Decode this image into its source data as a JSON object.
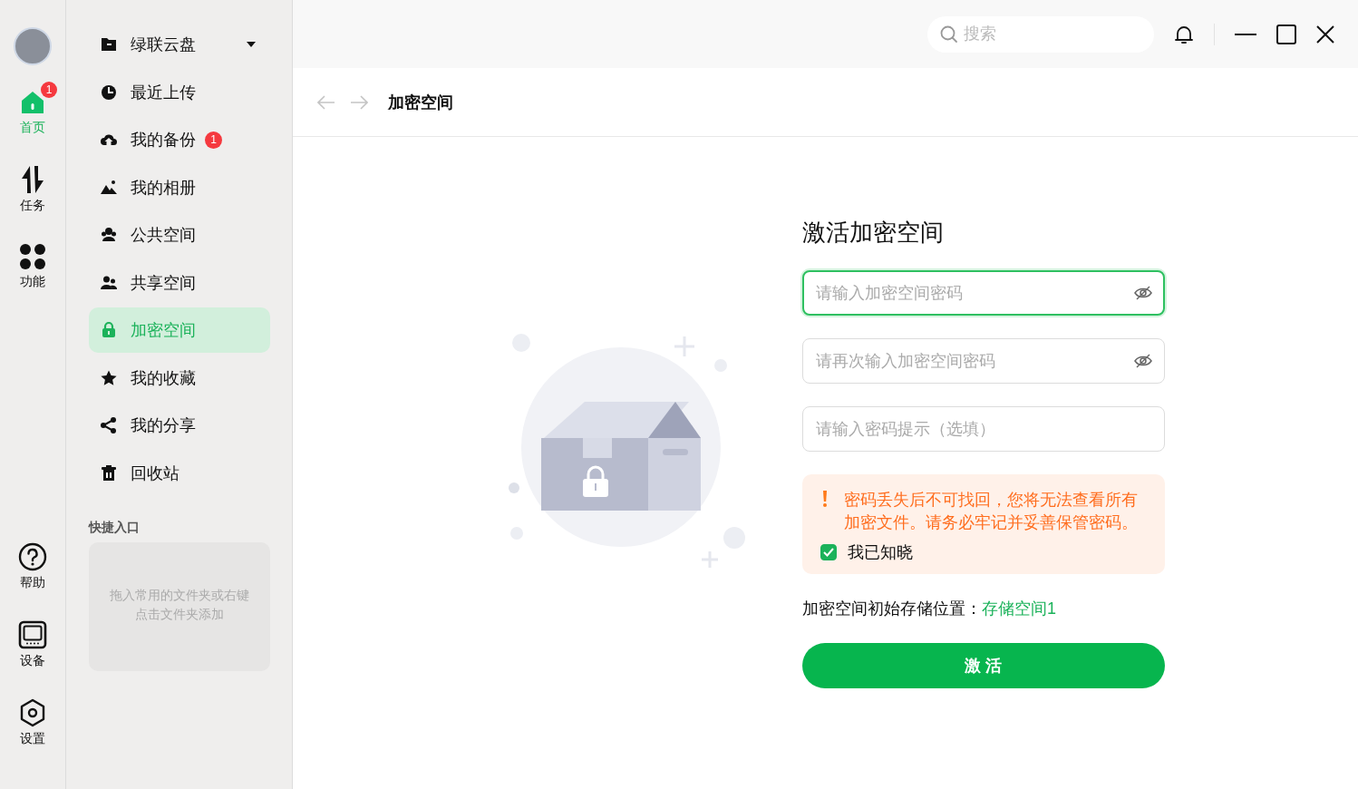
{
  "rail": {
    "items": [
      {
        "label": "首页",
        "selected": true,
        "badge": "1"
      },
      {
        "label": "任务",
        "selected": false
      },
      {
        "label": "功能",
        "selected": false
      }
    ],
    "bottom_items": [
      {
        "label": "帮助"
      },
      {
        "label": "设备"
      },
      {
        "label": "设置"
      }
    ]
  },
  "sidebar": {
    "items": [
      {
        "label": "绿联云盘",
        "selected": false,
        "kind": "dropdown"
      },
      {
        "label": "最近上传",
        "selected": false,
        "kind": "link"
      },
      {
        "label": "我的备份",
        "selected": false,
        "kind": "link",
        "badge": "1"
      },
      {
        "label": "我的相册",
        "selected": false,
        "kind": "link"
      },
      {
        "label": "公共空间",
        "selected": false,
        "kind": "link"
      },
      {
        "label": "共享空间",
        "selected": false,
        "kind": "link"
      },
      {
        "label": "加密空间",
        "selected": true,
        "kind": "link"
      },
      {
        "label": "我的收藏",
        "selected": false,
        "kind": "link"
      },
      {
        "label": "我的分享",
        "selected": false,
        "kind": "link"
      },
      {
        "label": "回收站",
        "selected": false,
        "kind": "link"
      }
    ],
    "shortcuts": {
      "title": "快捷入口",
      "hint": "拖入常用的文件夹或右键点击文件夹添加"
    }
  },
  "topbar": {
    "search": {
      "placeholder": "搜索"
    }
  },
  "breadcrumb": {
    "title": "加密空间"
  },
  "form": {
    "title": "激活加密空间",
    "fields": [
      {
        "placeholder": "请输入加密空间密码",
        "kind": "password",
        "focused": true
      },
      {
        "placeholder": "请再次输入加密空间密码",
        "kind": "password",
        "focused": false
      },
      {
        "placeholder": "请输入密码提示（选填）",
        "kind": "text",
        "focused": false
      }
    ],
    "warning": {
      "text": "密码丢失后不可找回，您将无法查看所有加密文件。请务必牢记并妥善保管密码。",
      "ack": {
        "label": "我已知晓",
        "checked": true
      }
    },
    "storage": {
      "label": "加密空间初始存储位置：",
      "value": "存储空间1"
    },
    "submit": "激 活"
  }
}
